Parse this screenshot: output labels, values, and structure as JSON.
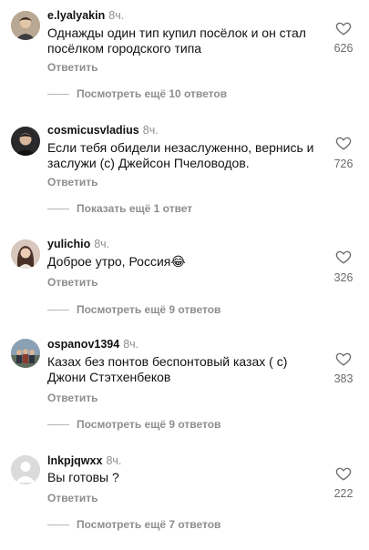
{
  "colors": {
    "text": "#111111",
    "muted": "#8e8e8e",
    "count": "#6b6b6b",
    "divider": "#b5b5b5"
  },
  "comments": [
    {
      "username": "e.lyalyakin",
      "time": "8ч.",
      "text": "Однажды один тип купил посёлок и он стал посёлком городского типа",
      "reply_label": "Ответить",
      "likes": "626",
      "more_replies": "Посмотреть ещё 10 ответов",
      "avatar_icon": "avatar-man-icon"
    },
    {
      "username": "cosmicusvladius",
      "time": "8ч.",
      "text": "Если тебя обидели незаслуженно, вернись и заслужи (с) Джейсон Пчеловодов.",
      "reply_label": "Ответить",
      "likes": "726",
      "more_replies": "Показать ещё 1 ответ",
      "avatar_icon": "avatar-man-dark-icon"
    },
    {
      "username": "yulichio",
      "time": "8ч.",
      "text": "Доброе утро, Россия😂",
      "reply_label": "Ответить",
      "likes": "326",
      "more_replies": "Посмотреть ещё 9 ответов",
      "avatar_icon": "avatar-woman-icon"
    },
    {
      "username": "ospanov1394",
      "time": "8ч.",
      "text": "Казах без понтов беспонтовый казах ( с) Джони Стэтхенбеков",
      "reply_label": "Ответить",
      "likes": "383",
      "more_replies": "Посмотреть ещё 9 ответов",
      "avatar_icon": "avatar-group-icon"
    },
    {
      "username": "lnkpjqwxx",
      "time": "8ч.",
      "text": "Вы готовы ?",
      "reply_label": "Ответить",
      "likes": "222",
      "more_replies": "Посмотреть ещё 7 ответов",
      "avatar_icon": "avatar-default-icon"
    }
  ]
}
